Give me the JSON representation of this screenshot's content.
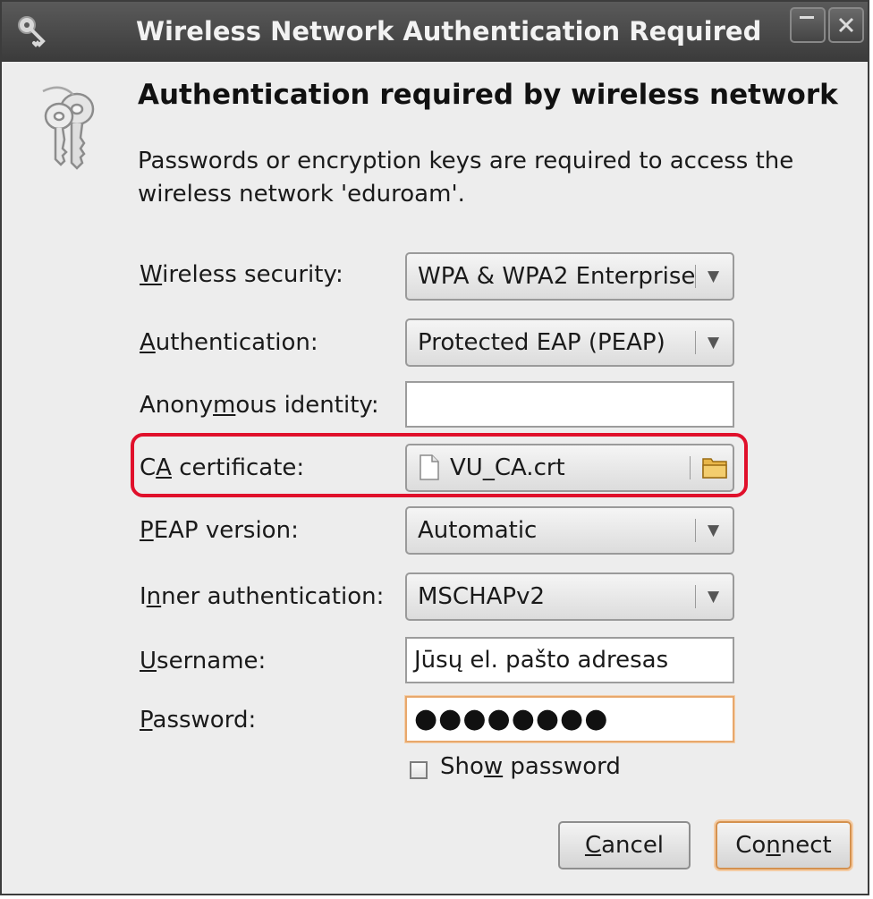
{
  "window": {
    "title": "Wireless Network Authentication Required"
  },
  "dialog": {
    "heading": "Authentication required by wireless network",
    "description": "Passwords or encryption keys are required to access the wireless network 'eduroam'."
  },
  "form": {
    "wireless_security": {
      "label_pre": "",
      "label_key": "W",
      "label_post": "ireless security:",
      "value": "WPA & WPA2 Enterprise"
    },
    "authentication": {
      "label_pre": "",
      "label_key": "A",
      "label_post": "uthentication:",
      "value": "Protected EAP (PEAP)"
    },
    "anonymous_identity": {
      "label_pre": "Anony",
      "label_key": "m",
      "label_post": "ous identity:",
      "value": ""
    },
    "ca_certificate": {
      "label_pre": "C",
      "label_key": "A",
      "label_post": " certificate:",
      "value": "VU_CA.crt"
    },
    "peap_version": {
      "label_pre": "",
      "label_key": "P",
      "label_post": "EAP version:",
      "value": "Automatic"
    },
    "inner_authentication": {
      "label_pre": "I",
      "label_key": "n",
      "label_post": "ner authentication:",
      "value": "MSCHAPv2"
    },
    "username": {
      "label_pre": "",
      "label_key": "U",
      "label_post": "sername:",
      "value": "Jūsų el. pašto adresas"
    },
    "password": {
      "label_pre": "",
      "label_key": "P",
      "label_post": "assword:",
      "value": "●●●●●●●●"
    },
    "show_password": {
      "label_pre": "Sho",
      "label_key": "w",
      "label_post": " password",
      "checked": false
    }
  },
  "buttons": {
    "cancel": {
      "pre": "",
      "key": "C",
      "post": "ancel"
    },
    "connect": {
      "pre": "Co",
      "key": "n",
      "post": "nect"
    }
  },
  "icons": {
    "title": "keys-icon",
    "dialog": "keys-icon",
    "file": "file-icon",
    "folder": "folder-icon",
    "dropdown": "dropdown-arrow-icon"
  },
  "colors": {
    "highlight": "#e0102b",
    "focus": "#e8a86c",
    "titlebar": "#3b3b3b",
    "background": "#ededed"
  }
}
